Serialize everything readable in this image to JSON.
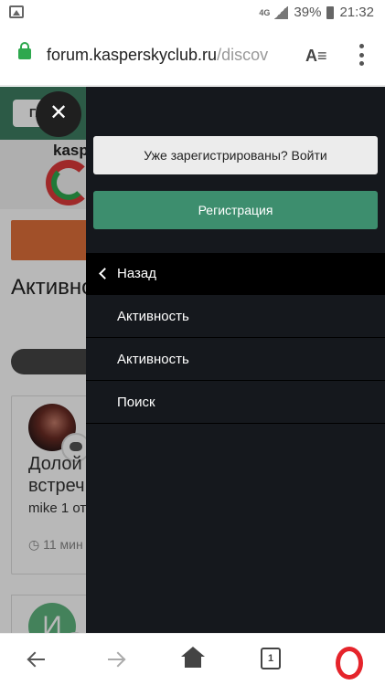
{
  "status_bar": {
    "network": "4G",
    "battery": "39%",
    "time": "21:32"
  },
  "browser": {
    "url_domain": "forum.kasperskyclub.ru",
    "url_path": "/discov",
    "tab_count": "1"
  },
  "background_page": {
    "home_label": "Гла",
    "logo_text": "kasp",
    "title": "Активнос",
    "post_title_line1": "Долой",
    "post_title_line2": "встреч",
    "post_author": "mike 1 от",
    "post_time": "11 мин",
    "avatar_letter": "И"
  },
  "drawer": {
    "login_button": "Уже зарегистрированы? Войти",
    "register_button": "Регистрация",
    "back_label": "Назад",
    "items": [
      {
        "label": "Активность"
      },
      {
        "label": "Активность"
      },
      {
        "label": "Поиск"
      }
    ]
  },
  "colors": {
    "drawer_bg": "#15181d",
    "register_green": "#3d8e6e",
    "lock_green": "#2ea84e",
    "opera_red": "#e5242b"
  }
}
